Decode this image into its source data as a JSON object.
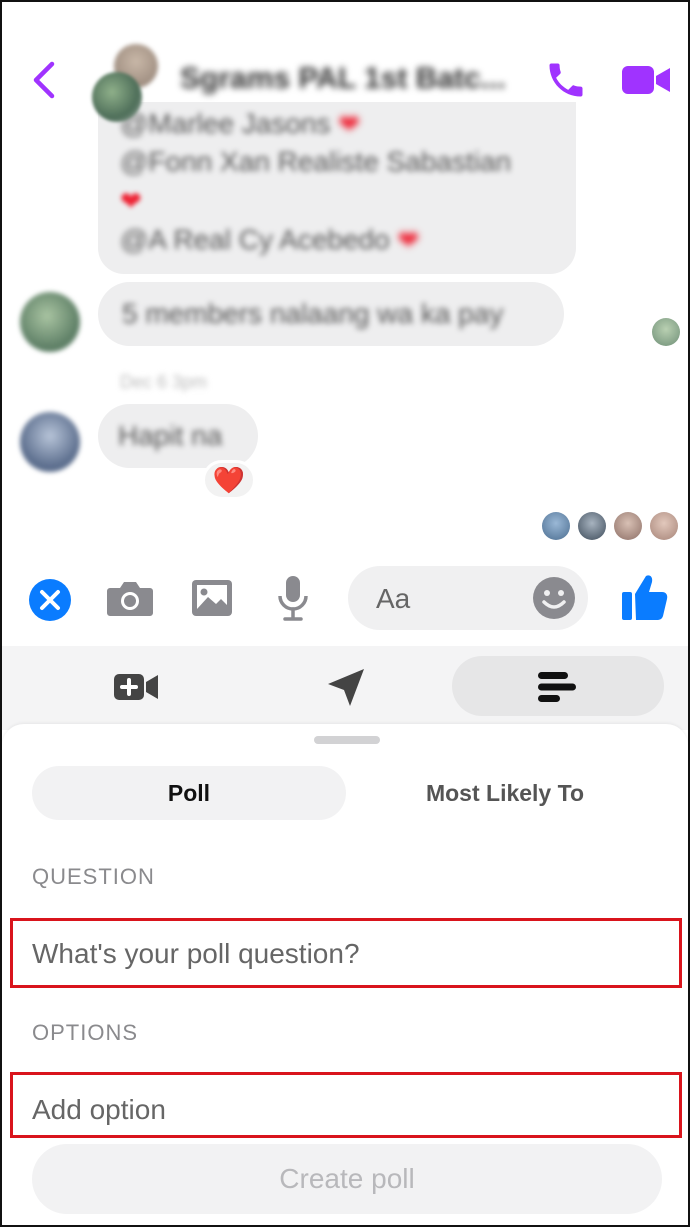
{
  "header": {
    "title": "Sgrams PAL 1st Batc...",
    "accent_color": "#a033ff"
  },
  "messages": {
    "lines": [
      "@Marlee Jasons",
      "@Fonn Xan Realiste Sabastian",
      "@A Real Cy Acebedo"
    ],
    "message_2": "5 members nalaang wa ka pay",
    "time": "Dec 6 3pm",
    "message_3": "Hapit na",
    "reaction": "❤️"
  },
  "composer": {
    "placeholder": "Aa",
    "accent_color": "#0a7cff"
  },
  "sheet": {
    "tabs": {
      "poll": "Poll",
      "most_likely": "Most Likely To"
    },
    "question_label": "QUESTION",
    "question_placeholder": "What's your poll question?",
    "options_label": "OPTIONS",
    "option_placeholder": "Add option",
    "create_button": "Create poll",
    "highlight_color": "#d9141c"
  },
  "icons": [
    "back-chevron-icon",
    "phone-icon",
    "video-camera-icon",
    "close-icon",
    "camera-icon",
    "image-icon",
    "microphone-icon",
    "emoji-icon",
    "thumbs-up-icon",
    "add-video-icon",
    "location-arrow-icon",
    "poll-icon"
  ]
}
